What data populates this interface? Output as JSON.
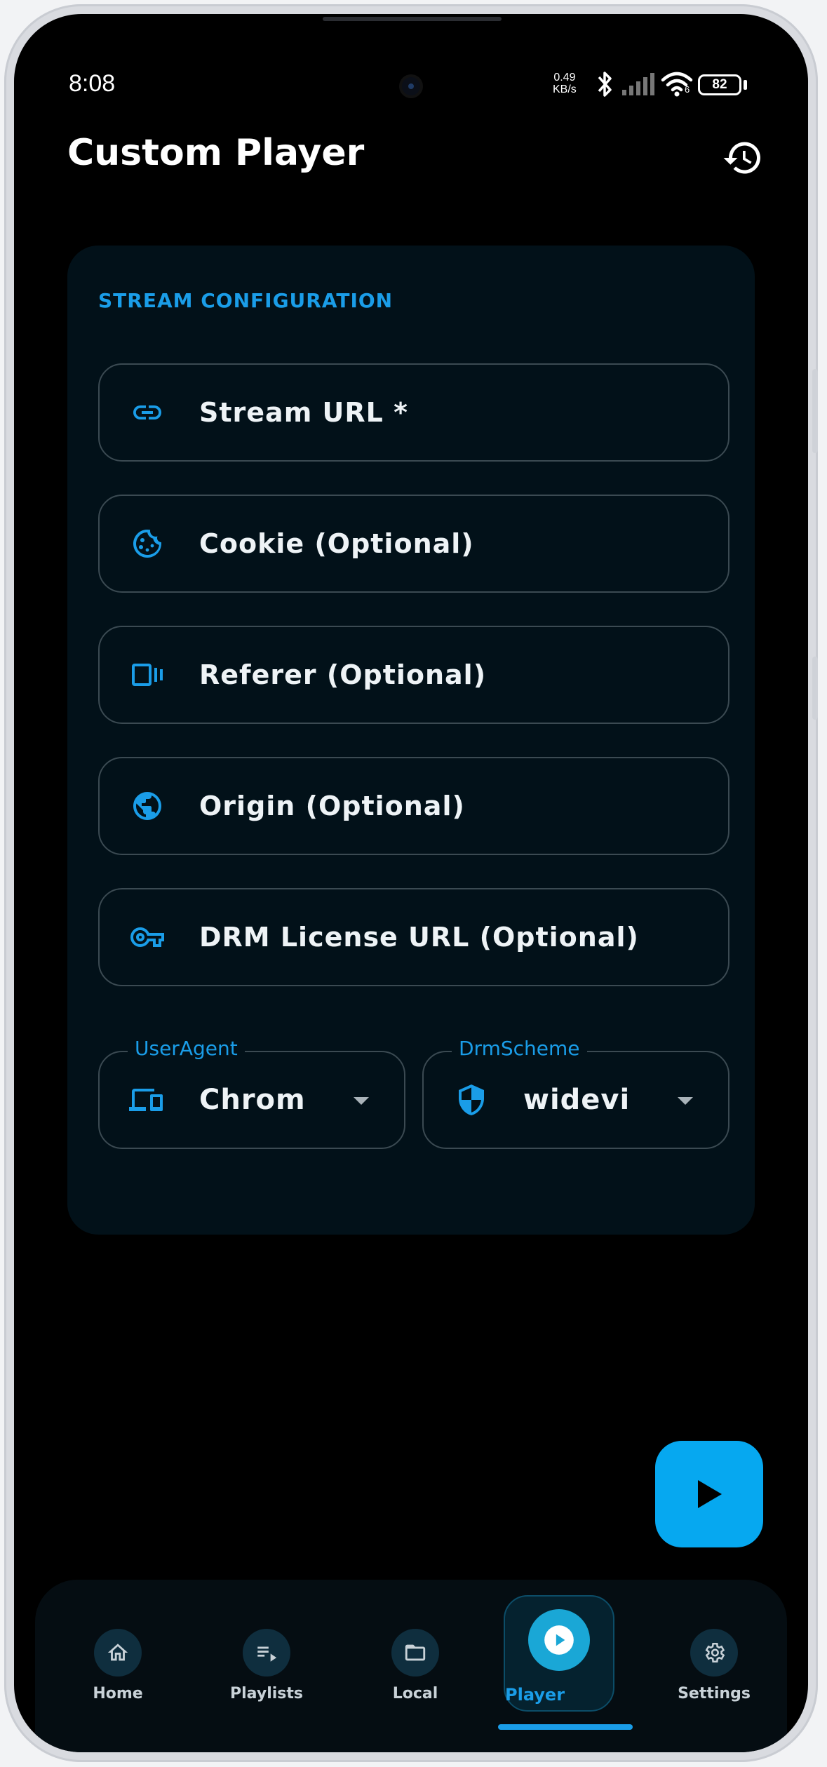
{
  "status_bar": {
    "time": "8:08",
    "net_speed_value": "0.49",
    "net_speed_unit": "KB/s",
    "signal_sub": "6",
    "battery": "82"
  },
  "header": {
    "title": "Custom Player",
    "history_icon": "history-icon"
  },
  "card": {
    "section_title": "STREAM CONFIGURATION",
    "fields": [
      {
        "label": "Stream URL *",
        "icon": "link-icon"
      },
      {
        "label": "Cookie (Optional)",
        "icon": "cookie-icon"
      },
      {
        "label": "Referer (Optional)",
        "icon": "referer-icon"
      },
      {
        "label": "Origin (Optional)",
        "icon": "globe-icon"
      },
      {
        "label": "DRM License URL (Optional)",
        "icon": "key-icon"
      }
    ],
    "user_agent": {
      "legend": "UserAgent",
      "value": "Chrome",
      "icon": "devices-icon"
    },
    "drm_scheme": {
      "legend": "DrmScheme",
      "value": "widevine",
      "icon": "shield-icon"
    }
  },
  "fab": {
    "icon": "play-icon"
  },
  "nav": {
    "items": [
      {
        "label": "Home",
        "icon": "home-icon"
      },
      {
        "label": "Playlists",
        "icon": "playlist-icon"
      },
      {
        "label": "Local",
        "icon": "folder-icon"
      },
      {
        "label": "Player",
        "icon": "play-circle-icon",
        "active": true
      },
      {
        "label": "Settings",
        "icon": "gear-icon"
      }
    ]
  },
  "colors": {
    "accent": "#1a9de8",
    "fab": "#06a8f0",
    "card_bg": "#021119",
    "background": "#000000"
  }
}
